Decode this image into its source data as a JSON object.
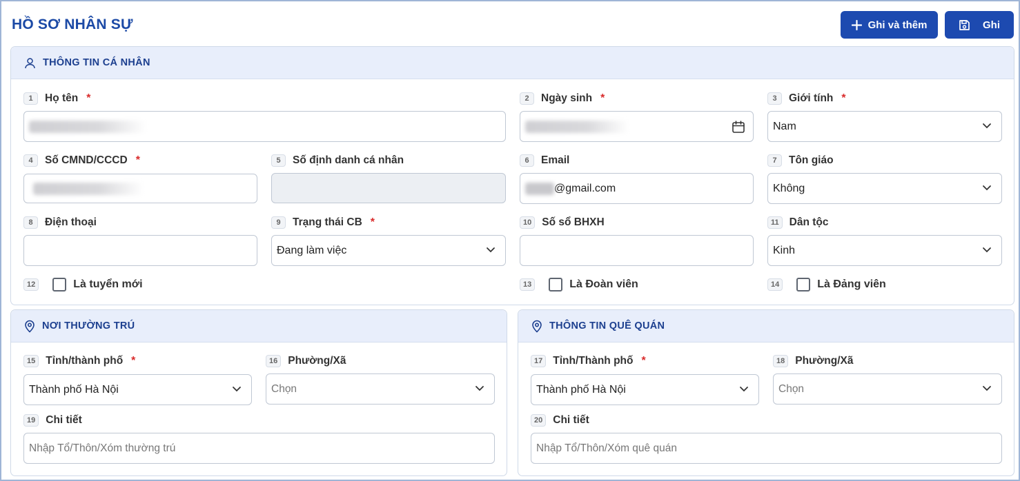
{
  "page": {
    "title": "HỒ SƠ NHÂN SỰ"
  },
  "toolbar": {
    "save_add_label": "Ghi và thêm",
    "save_label": "Ghi"
  },
  "personal": {
    "title": "THÔNG TIN CÁ NHÂN",
    "ho_ten": {
      "num": "1",
      "label": "Họ tên",
      "required": "*"
    },
    "ngay_sinh": {
      "num": "2",
      "label": "Ngày sinh",
      "required": "*"
    },
    "gioi_tinh": {
      "num": "3",
      "label": "Giới tính",
      "required": "*",
      "value": "Nam"
    },
    "cmnd": {
      "num": "4",
      "label": "Số CMND/CCCD",
      "required": "*"
    },
    "so_dinh_danh": {
      "num": "5",
      "label": "Số định danh cá nhân"
    },
    "email": {
      "num": "6",
      "label": "Email",
      "value_suffix": "@gmail.com"
    },
    "ton_giao": {
      "num": "7",
      "label": "Tôn giáo",
      "value": "Không"
    },
    "dien_thoai": {
      "num": "8",
      "label": "Điện thoại"
    },
    "trang_thai": {
      "num": "9",
      "label": "Trạng thái CB",
      "required": "*",
      "value": "Đang làm việc"
    },
    "so_bhxh": {
      "num": "10",
      "label": "Số sổ BHXH"
    },
    "dan_toc": {
      "num": "11",
      "label": "Dân tộc",
      "value": "Kinh"
    },
    "tuyen_moi": {
      "num": "12",
      "label": "Là tuyển mới"
    },
    "doan_vien": {
      "num": "13",
      "label": "Là Đoàn viên"
    },
    "dang_vien": {
      "num": "14",
      "label": "Là Đảng viên"
    }
  },
  "residence": {
    "title": "NƠI THƯỜNG TRÚ",
    "tinh": {
      "num": "15",
      "label": "Tỉnh/thành phố",
      "required": "*",
      "value": "Thành phố Hà Nội"
    },
    "phuong": {
      "num": "16",
      "label": "Phường/Xã",
      "placeholder": "Chọn"
    },
    "chi_tiet": {
      "num": "19",
      "label": "Chi tiết",
      "placeholder": "Nhập Tổ/Thôn/Xóm thường trú"
    }
  },
  "hometown": {
    "title": "THÔNG TIN QUÊ QUÁN",
    "tinh": {
      "num": "17",
      "label": "Tỉnh/Thành phố",
      "required": "*",
      "value": "Thành phố Hà Nội"
    },
    "phuong": {
      "num": "18",
      "label": "Phường/Xã",
      "placeholder": "Chọn"
    },
    "chi_tiet": {
      "num": "20",
      "label": "Chi tiết",
      "placeholder": "Nhập Tổ/Thôn/Xóm quê quán"
    }
  },
  "icons": {
    "plus": "plus-icon",
    "save": "floppy-disk-icon",
    "user": "user-icon",
    "location": "map-pin-icon",
    "calendar": "calendar-icon",
    "chevron": "chevron-down-icon"
  },
  "colors": {
    "primary": "#1d4ab0",
    "title": "#1c4aa6",
    "panel_head": "#e8eefb",
    "required": "#d92b2b"
  }
}
